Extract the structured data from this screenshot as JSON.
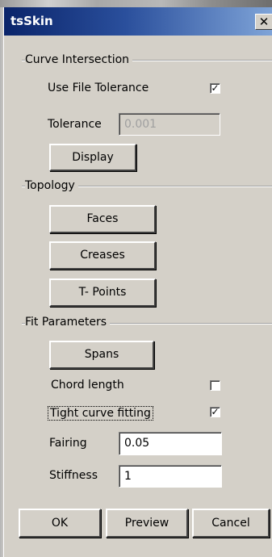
{
  "window": {
    "title": "tsSkin",
    "close_glyph": "✕"
  },
  "curve_intersection": {
    "group_label": "Curve Intersection",
    "use_file_tolerance_label": "Use File Tolerance",
    "use_file_tolerance_checked": true,
    "tolerance_label": "Tolerance",
    "tolerance_value": "0.001",
    "display_button": "Display"
  },
  "topology": {
    "group_label": "Topology",
    "faces_button": "Faces",
    "creases_button": "Creases",
    "tpoints_button": "T- Points"
  },
  "fit_parameters": {
    "group_label": "Fit Parameters",
    "spans_button": "Spans",
    "chord_length_label": "Chord length",
    "chord_length_checked": false,
    "tight_curve_label": "Tight curve fitting",
    "tight_curve_checked": true,
    "fairing_label": "Fairing",
    "fairing_value": "0.05",
    "stiffness_label": "Stiffness",
    "stiffness_value": "1"
  },
  "footer": {
    "ok_button": "OK",
    "preview_button": "Preview",
    "cancel_button": "Cancel"
  },
  "colors": {
    "dialog_bg": "#d4d0c8",
    "titlebar_start": "#0a246a",
    "titlebar_end": "#7fa4d8"
  },
  "check_glyph": "✓"
}
